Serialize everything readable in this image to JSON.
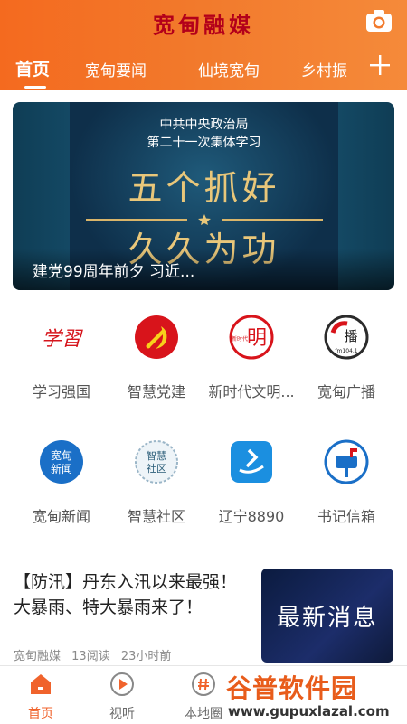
{
  "header": {
    "brand": "宽甸融媒",
    "tabs": [
      {
        "label": "首页",
        "active": true
      },
      {
        "label": "宽甸要闻"
      },
      {
        "label": "仙境宽甸"
      },
      {
        "label": "乡村振"
      }
    ],
    "accent_color": "#f46a1f"
  },
  "banner": {
    "sub_line1": "中共中央政治局",
    "sub_line2": "第二十一次集体学习",
    "main_line1": "五个抓好",
    "main_line2": "久久为功",
    "caption": "建党99周年前夕 习近..."
  },
  "grid": [
    {
      "label": "学习强国",
      "icon": "xuexi-icon"
    },
    {
      "label": "智慧党建",
      "icon": "party-emblem-icon"
    },
    {
      "label": "新时代文明...",
      "icon": "civilization-icon"
    },
    {
      "label": "宽甸广播",
      "icon": "radio-icon"
    },
    {
      "label": "宽甸新闻",
      "icon": "news-icon"
    },
    {
      "label": "智慧社区",
      "icon": "community-icon"
    },
    {
      "label": "辽宁8890",
      "icon": "liaoning-icon"
    },
    {
      "label": "书记信箱",
      "icon": "mailbox-icon"
    }
  ],
  "icon_text": {
    "xuexi": "学習",
    "civilization": "明",
    "civilization_small": "新时代",
    "radio": "播",
    "radio_fm": "fm104.1",
    "news_line1": "宽甸",
    "news_line2": "新闻",
    "community_line1": "智慧",
    "community_line2": "社区"
  },
  "news": {
    "title": "【防汛】丹东入汛以来最强！大暴雨、特大暴雨来了！",
    "source": "宽甸融媒",
    "reads": "13阅读",
    "time": "23小时前",
    "thumb_text": "最新消息"
  },
  "bottom_nav": [
    {
      "label": "首页",
      "active": true
    },
    {
      "label": "视听"
    },
    {
      "label": "本地圈"
    }
  ],
  "watermark": {
    "main": "谷普软件园",
    "sub": "www.gupuxlazal.com"
  }
}
